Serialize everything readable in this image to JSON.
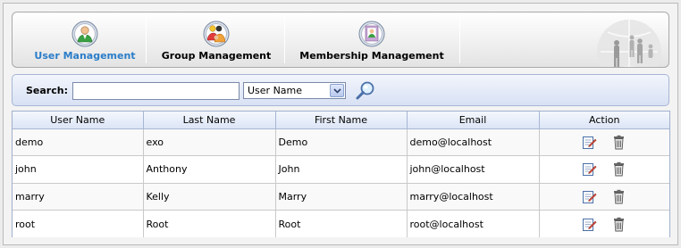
{
  "tabs": [
    {
      "label": "User Management",
      "icon": "user-icon",
      "active": true
    },
    {
      "label": "Group Management",
      "icon": "group-icon",
      "active": false
    },
    {
      "label": "Membership Management",
      "icon": "membership-icon",
      "active": false
    }
  ],
  "search": {
    "label": "Search:",
    "value": "",
    "filter_selected": "User Name"
  },
  "table": {
    "headers": [
      "User Name",
      "Last Name",
      "First Name",
      "Email",
      "Action"
    ],
    "rows": [
      {
        "username": "demo",
        "lastname": "exo",
        "firstname": "Demo",
        "email": "demo@localhost"
      },
      {
        "username": "john",
        "lastname": "Anthony",
        "firstname": "John",
        "email": "john@localhost"
      },
      {
        "username": "marry",
        "lastname": "Kelly",
        "firstname": "Marry",
        "email": "marry@localhost"
      },
      {
        "username": "root",
        "lastname": "Root",
        "firstname": "Root",
        "email": "root@localhost"
      }
    ],
    "actions": [
      "edit-icon",
      "delete-icon"
    ]
  },
  "colors": {
    "active_tab": "#2a7dc8",
    "searchbar_bg": "#d8e1f4",
    "header_bg": "#dce5f6"
  }
}
